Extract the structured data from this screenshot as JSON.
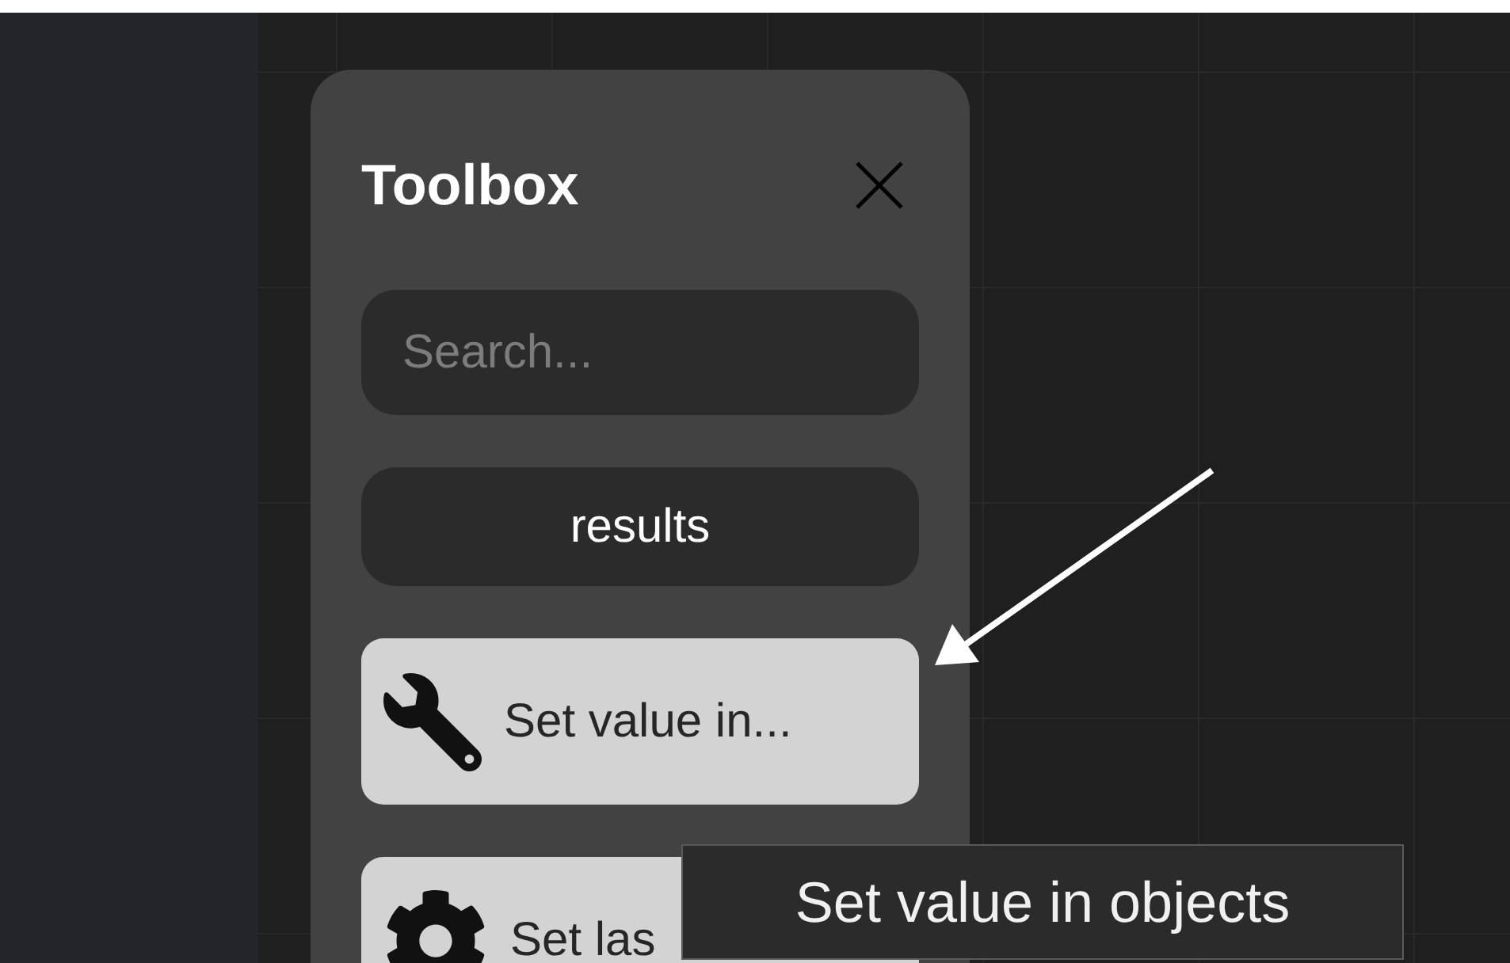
{
  "toolbox": {
    "title": "Toolbox",
    "search": {
      "placeholder": "Search..."
    },
    "results_button": "results",
    "tools": [
      {
        "label": "Set value in...",
        "kind": "wrench"
      },
      {
        "label": "Set las",
        "kind": "gear"
      }
    ]
  },
  "tooltip": "Set value in objects"
}
